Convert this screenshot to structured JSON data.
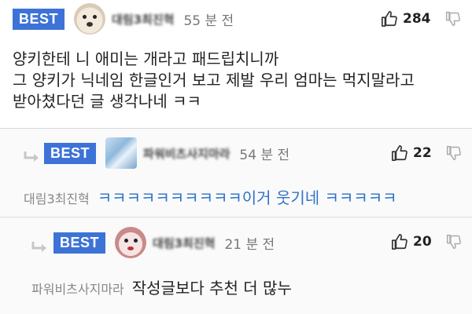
{
  "comments": [
    {
      "badge": "BEST",
      "nickname": "대림3최진혁",
      "time": "55 분 전",
      "upvotes": "284",
      "avatar": "dog-avatar",
      "lines": [
        "양키한테 니 애미는 개라고 패드립치니까",
        "그 양키가 닉네임 한글인거 보고 제발 우리 엄마는 먹지말라고",
        "받아쳤다던 글 생각나네 ㅋㅋ"
      ]
    },
    {
      "badge": "BEST",
      "nickname": "파워비츠사지마라",
      "time": "54 분 전",
      "upvotes": "22",
      "avatar": "ice-avatar",
      "reply_to": "대림3최진혁",
      "body": "ㅋㅋㅋㅋㅋㅋㅋㅋㅋㅋ이거 웃기네 ㅋㅋㅋㅋㅋ"
    },
    {
      "badge": "BEST",
      "nickname": "대림3최진혁",
      "time": "21 분 전",
      "upvotes": "20",
      "avatar": "pink-avatar",
      "reply_to": "파워비츠사지마라",
      "body": "작성글보다 추천 더 많누"
    }
  ],
  "colors": {
    "best_badge": "#3d73d6",
    "reply_text_blue": "#2f72c9"
  },
  "icons": [
    "thumb-up-icon",
    "thumb-down-icon",
    "reply-arrow-icon"
  ]
}
